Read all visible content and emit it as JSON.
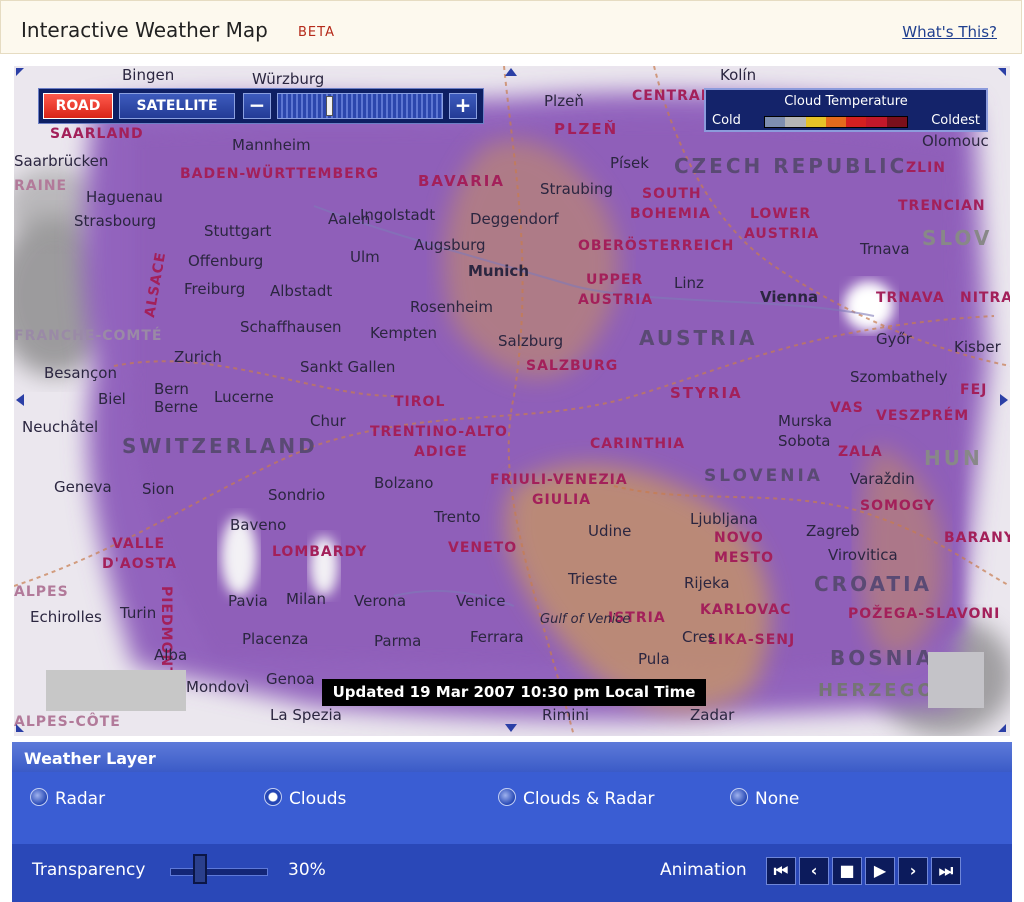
{
  "header": {
    "title": "Interactive Weather Map",
    "badge": "BETA",
    "help_link": "What's This?"
  },
  "map": {
    "controls": {
      "road_label": "ROAD",
      "satellite_label": "SATELLITE",
      "zoom_out_label": "−",
      "zoom_in_label": "+"
    },
    "legend": {
      "title": "Cloud Temperature",
      "cold": "Cold",
      "coldest": "Coldest",
      "colors": [
        "#7e8eb0",
        "#b5b5b5",
        "#e6c227",
        "#e46a1d",
        "#d42020",
        "#c2182a",
        "#7a0f1b"
      ]
    },
    "updated_text": "Updated 19 Mar 2007 10:30 pm Local Time",
    "labels": {
      "countries": [
        "CZECH REPUBLIC",
        "AUSTRIA",
        "SWITZERLAND",
        "CROATIA",
        "SLOVENIA",
        "BOSNIA",
        "HERZEGO",
        "SLOV",
        "HUN"
      ],
      "regions": [
        "SAARLAND",
        "BADEN-WÜRTTEMBERG",
        "BAVARIA",
        "PLZEŇ",
        "CENTRAL BOHEM",
        "SOUTH",
        "BOHEMIA",
        "LOWER",
        "AUSTRIA",
        "ZLIN",
        "TRENCIAN",
        "TRNAVA",
        "NITRA",
        "OBERÖSTERREICH",
        "UPPER",
        "AUSTRIA",
        "SALZBURG",
        "TIROL",
        "TRENTINO-ALTO",
        "ADIGE",
        "STYRIA",
        "CARINTHIA",
        "VAS",
        "VESZPRÉM",
        "ZALA",
        "FEJ",
        "FRIULI-VENEZIA",
        "GIULIA",
        "SOMOGY",
        "BARANYA",
        "LOMBARDY",
        "VENETO",
        "VALLE",
        "D'AOSTA",
        "PIEDMONT",
        "ISTRIA",
        "KARLOVAC",
        "NOVO",
        "MESTO",
        "LIKA-SENJ",
        "POŽEGA-SLAVONI",
        "ALSACE",
        "FRANCHE-COMTÉ",
        "RAINE",
        "ALPES",
        "ALPES-CÔTE"
      ],
      "cities": [
        "Bingen",
        "Würzburg",
        "Plzeň",
        "Kolín",
        "Saarbrücken",
        "Mannheim",
        "Písek",
        "Olomouc",
        "Haguenau",
        "Straubing",
        "Strasbourg",
        "Aalen",
        "Ingolstadt",
        "Deggendorf",
        "Stuttgart",
        "Augsburg",
        "Trnava",
        "Offenburg",
        "Ulm",
        "Munich",
        "Linz",
        "Freiburg",
        "Albstadt",
        "Rosenheim",
        "Vienna",
        "Schaffhausen",
        "Kempten",
        "Salzburg",
        "Győr",
        "Kisber",
        "Besançon",
        "Zurich",
        "Sankt Gallen",
        "Szombathely",
        "Biel",
        "Bern",
        "Berne",
        "Lucerne",
        "Chur",
        "Neuchâtel",
        "Murska",
        "Sobota",
        "Geneva",
        "Sion",
        "Sondrio",
        "Bolzano",
        "Varaždin",
        "Trento",
        "Udine",
        "Ljubljana",
        "Baveno",
        "Zagreb",
        "Virovitica",
        "Turin",
        "Pavia",
        "Milan",
        "Verona",
        "Venice",
        "Trieste",
        "Rijeka",
        "Echirolles",
        "Placenza",
        "Parma",
        "Ferrara",
        "Gulf of Venice",
        "Cres",
        "Alba",
        "Mondovì",
        "Genoa",
        "Pula",
        "La Spezia",
        "Rimini",
        "Zadar",
        "Neuchatel"
      ]
    }
  },
  "weather_layer": {
    "title": "Weather Layer",
    "options": [
      {
        "label": "Radar",
        "selected": false
      },
      {
        "label": "Clouds",
        "selected": true
      },
      {
        "label": "Clouds & Radar",
        "selected": false
      },
      {
        "label": "None",
        "selected": false
      }
    ],
    "transparency_label": "Transparency",
    "transparency_value": "30%",
    "transparency_fraction": 0.3,
    "animation_label": "Animation",
    "animation_buttons": [
      "first",
      "previous",
      "stop",
      "play",
      "next",
      "last"
    ]
  }
}
